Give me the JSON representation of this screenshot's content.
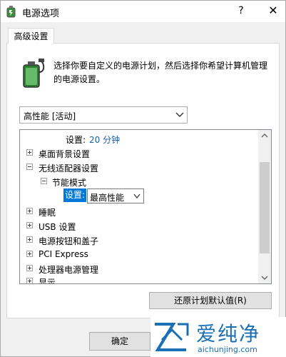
{
  "window": {
    "title": "电源选项",
    "help_label": "?",
    "close_label": "✕"
  },
  "tab": {
    "label": "高级设置"
  },
  "description": "选择你要自定义的电源计划，然后选择你希望计算机管理的电源设置。",
  "plan_select": {
    "value": "高性能 [活动]"
  },
  "tree": {
    "top_setting": {
      "label": "设置:",
      "value": "20 分钟"
    },
    "items": [
      {
        "label": "桌面背景设置"
      },
      {
        "label": "无线适配器设置"
      },
      {
        "label": "节能模式"
      },
      {
        "label": "睡眠"
      },
      {
        "label": "USB 设置"
      },
      {
        "label": "电源按钮和盖子"
      },
      {
        "label": "PCI Express"
      },
      {
        "label": "处理器电源管理"
      },
      {
        "label": "显示"
      }
    ],
    "selected_setting": {
      "label": "设置:",
      "value": "最高性能"
    }
  },
  "buttons": {
    "restore": "还原计划默认值(R)",
    "ok": "确定"
  },
  "watermark": {
    "title": "爱纯净",
    "url": "aichunjing.com"
  },
  "colors": {
    "selection": "#0078d7",
    "setting_value": "#1f5fa8",
    "watermark": "#1a6fb5"
  }
}
